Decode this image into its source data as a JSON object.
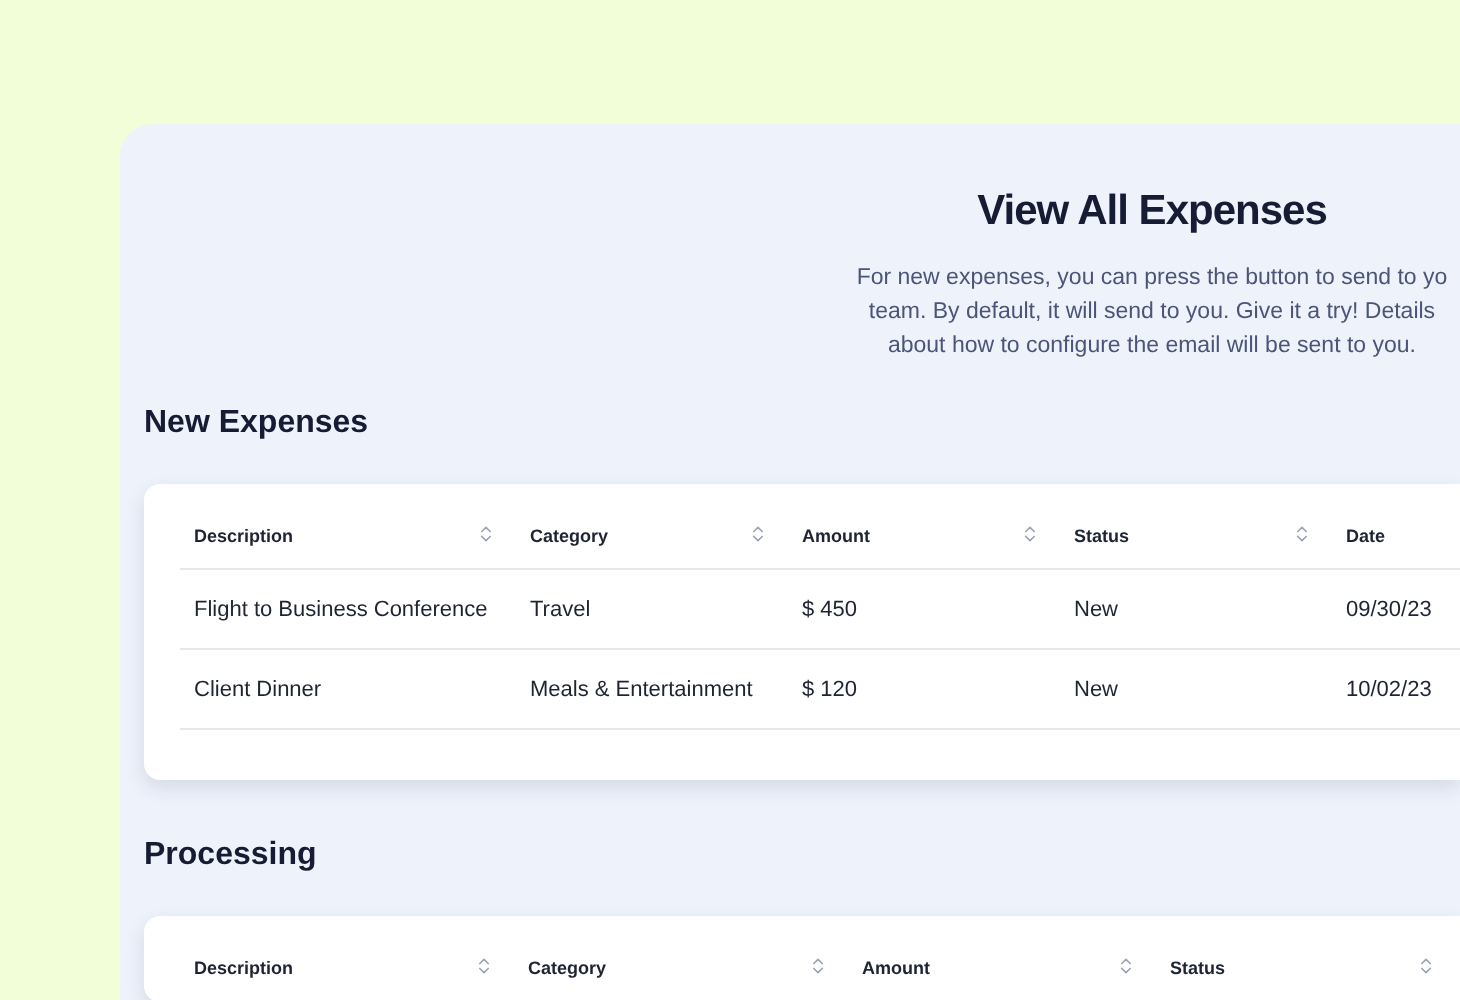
{
  "header": {
    "title": "View All Expenses",
    "description_lines": [
      "For new expenses, you can press the button to send to yo",
      "team. By default, it will send to you. Give it a try! Details",
      "about how to configure the email will be sent to you."
    ]
  },
  "sections": [
    {
      "title": "New Expenses",
      "columns": [
        "Description",
        "Category",
        "Amount",
        "Status",
        "Date"
      ],
      "rows": [
        [
          "Flight to Business Conference",
          "Travel",
          "$ 450",
          "New",
          "09/30/23"
        ],
        [
          "Client Dinner",
          "Meals & Entertainment",
          "$ 120",
          "New",
          "10/02/23"
        ]
      ]
    },
    {
      "title": "Processing",
      "columns": [
        "Description",
        "Category",
        "Amount",
        "Status"
      ]
    }
  ]
}
